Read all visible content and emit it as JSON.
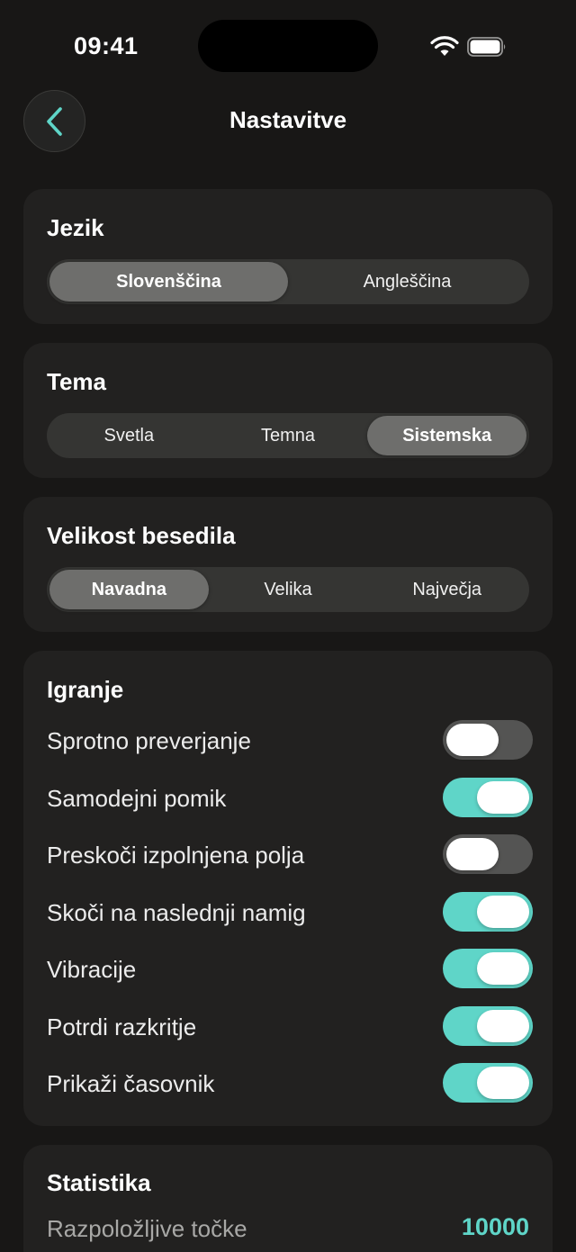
{
  "status_bar": {
    "time": "09:41"
  },
  "header": {
    "title": "Nastavitve"
  },
  "language": {
    "title": "Jezik",
    "options": [
      "Slovenščina",
      "Angleščina"
    ],
    "selected": "Slovenščina"
  },
  "theme": {
    "title": "Tema",
    "options": [
      "Svetla",
      "Temna",
      "Sistemska"
    ],
    "selected": "Sistemska"
  },
  "text_size": {
    "title": "Velikost besedila",
    "options": [
      "Navadna",
      "Velika",
      "Največja"
    ],
    "selected": "Navadna"
  },
  "gameplay": {
    "title": "Igranje",
    "items": [
      {
        "label": "Sprotno preverjanje",
        "on": false
      },
      {
        "label": "Samodejni pomik",
        "on": true
      },
      {
        "label": "Preskoči izpolnjena polja",
        "on": false
      },
      {
        "label": "Skoči na naslednji namig",
        "on": true
      },
      {
        "label": "Vibracije",
        "on": true
      },
      {
        "label": "Potrdi razkritje",
        "on": true
      },
      {
        "label": "Prikaži časovnik",
        "on": true
      }
    ]
  },
  "statistics": {
    "title": "Statistika",
    "points_label": "Razpoložljive točke",
    "points_value": "10000"
  },
  "colors": {
    "background": "#181716",
    "card": "#222120",
    "accent": "#5fd5c8",
    "toggle_off": "#545453"
  }
}
